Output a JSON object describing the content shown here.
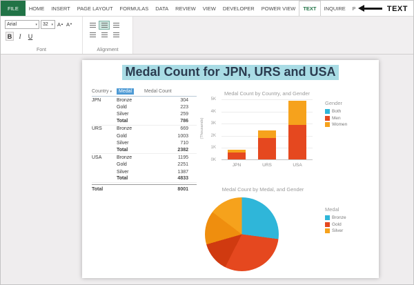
{
  "icons": {
    "dropdown_caret": "▾",
    "up_caret": "▲",
    "down_caret": "▼"
  },
  "ribbon": {
    "tabs": [
      {
        "label": "FILE",
        "file": true
      },
      {
        "label": "HOME"
      },
      {
        "label": "INSERT"
      },
      {
        "label": "PAGE LAYOUT"
      },
      {
        "label": "FORMULAS"
      },
      {
        "label": "DATA"
      },
      {
        "label": "REVIEW"
      },
      {
        "label": "VIEW"
      },
      {
        "label": "DEVELOPER"
      },
      {
        "label": "POWER VIEW"
      },
      {
        "label": "TEXT",
        "active": true
      },
      {
        "label": "INQUIRE"
      },
      {
        "label": "POWERPIVOT"
      }
    ],
    "annotation_label": "TEXT",
    "font_group": {
      "label": "Font",
      "font_name": "Arial",
      "font_size": "32",
      "grow_font": "A",
      "shrink_font": "A",
      "bold": "B",
      "italic": "I",
      "underline": "U"
    },
    "alignment_group": {
      "label": "Alignment"
    }
  },
  "report": {
    "title": "Medal Count for JPN, URS and USA",
    "table": {
      "columns": [
        "Country",
        "Medal",
        "Medal Count"
      ],
      "total_label": "Total",
      "groups": [
        {
          "country": "JPN",
          "rows": [
            {
              "medal": "Bronze",
              "count": "304"
            },
            {
              "medal": "Gold",
              "count": "223"
            },
            {
              "medal": "Silver",
              "count": "259"
            }
          ],
          "total": "786"
        },
        {
          "country": "URS",
          "rows": [
            {
              "medal": "Bronze",
              "count": "669"
            },
            {
              "medal": "Gold",
              "count": "1003"
            },
            {
              "medal": "Silver",
              "count": "710"
            }
          ],
          "total": "2382"
        },
        {
          "country": "USA",
          "rows": [
            {
              "medal": "Bronze",
              "count": "1195"
            },
            {
              "medal": "Gold",
              "count": "2251"
            },
            {
              "medal": "Silver",
              "count": "1387"
            }
          ],
          "total": "4833"
        }
      ],
      "grand_total_label": "Total",
      "grand_total": "8001"
    }
  },
  "chart_data": [
    {
      "type": "bar",
      "title": "Medal Count by Country, and Gender",
      "stacked": true,
      "categories": [
        "JPN",
        "URS",
        "USA"
      ],
      "series": [
        {
          "name": "Both",
          "color": "#2fb6d9",
          "values": [
            0,
            0,
            0
          ]
        },
        {
          "name": "Men",
          "color": "#e5481f",
          "values": [
            550,
            1750,
            2850
          ]
        },
        {
          "name": "Women",
          "color": "#f6a21c",
          "values": [
            236,
            632,
            1983
          ]
        }
      ],
      "ylabel": "(Thousands)",
      "yticks": [
        "0K",
        "1K",
        "2K",
        "3K",
        "4K",
        "5K"
      ],
      "ymax": 5000,
      "legend_title": "Gender",
      "legend_position": "right",
      "grid": true
    },
    {
      "type": "pie",
      "title": "Medal Count by Medal, and Gender",
      "legend_title": "Medal",
      "legend_position": "right",
      "legend": [
        {
          "label": "Bronze",
          "color": "#2fb6d9"
        },
        {
          "label": "Gold",
          "color": "#e5481f"
        },
        {
          "label": "Silver",
          "color": "#f6a21c"
        }
      ],
      "slices": [
        {
          "label": "Bronze",
          "value": 2168,
          "color": "#2fb6d9"
        },
        {
          "label": "Gold - Men",
          "value": 2430,
          "color": "#e5481f"
        },
        {
          "label": "Gold - Women",
          "value": 1047,
          "color": "#d03a10"
        },
        {
          "label": "Silver - Men",
          "value": 1180,
          "color": "#ef8e0e"
        },
        {
          "label": "Silver - Women",
          "value": 1176,
          "color": "#f6a21c"
        }
      ]
    }
  ],
  "colors": {
    "excel_green": "#217346",
    "selection_teal": "#a9dce5",
    "medal_header_blue": "#4f9bd5"
  }
}
